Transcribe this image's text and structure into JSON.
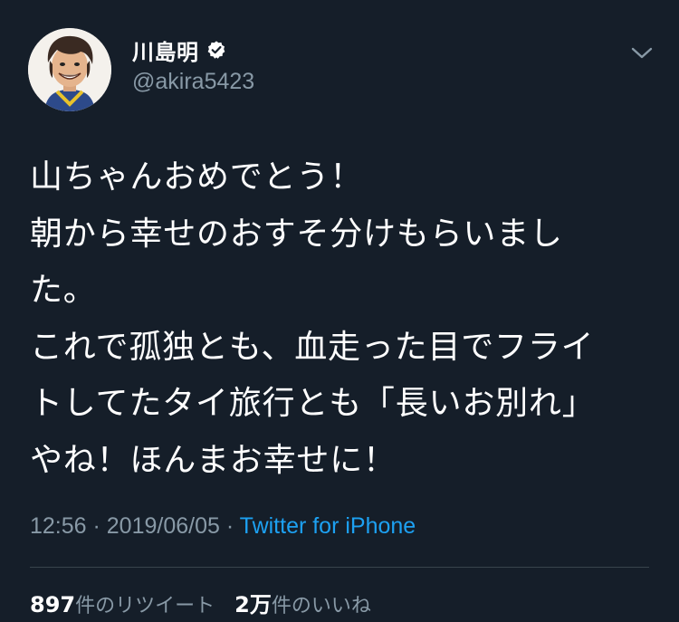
{
  "author": {
    "display_name": "川島明",
    "handle": "@akira5423",
    "verified": true
  },
  "icons": {
    "verified": "verified-badge-icon",
    "menu": "chevron-down-icon"
  },
  "tweet": {
    "lines": [
      "山ちゃんおめでとう！",
      "朝から幸せのおすそ分けもらいまし",
      "た。",
      "これで孤独とも、血走った目でフライ",
      "トしてたタイ旅行とも「長いお別れ」",
      "やね！ほんまお幸せに！"
    ],
    "time": "12:56",
    "separator1": " · ",
    "date": "2019/06/05",
    "separator2": " · ",
    "source": "Twitter for iPhone"
  },
  "stats": {
    "retweets_count": "897",
    "retweets_label": "件のリツイート",
    "likes_count": "2万",
    "likes_label": "件のいいね"
  },
  "colors": {
    "background": "#151e29",
    "text": "#ffffff",
    "secondary": "#8899a6",
    "accent": "#1da1f2",
    "divider": "#38444d"
  }
}
